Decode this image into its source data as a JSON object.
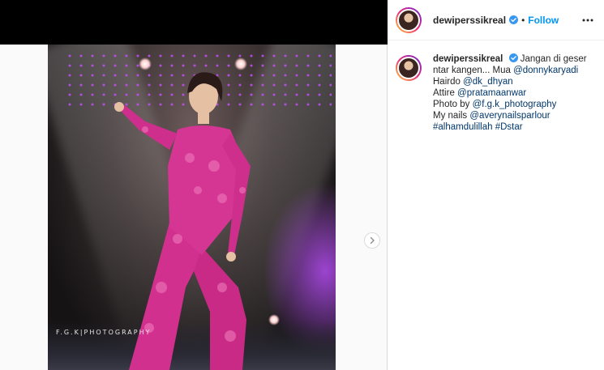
{
  "post": {
    "username": "dewiperssikreal",
    "separator": "•",
    "follow_label": "Follow",
    "watermark": "F.G.K|PHOTOGRAPHY"
  },
  "caption": {
    "line1_text": "Jangan di geser",
    "line2_text": "ntar kangen... Mua ",
    "line2_link": "@donnykaryadi",
    "line3_text": "Hairdo ",
    "line3_link": "@dk_dhyan",
    "line4_text": "Attire ",
    "line4_link": "@pratamaanwar",
    "line5_text": "Photo by ",
    "line5_link": "@f.g.k_photography",
    "line6_text": "My nails ",
    "line6_link": "@averynailsparlour",
    "line7_link1": "#alhamdulillah",
    "line7_link2": "#Dstar"
  },
  "icons": {
    "verified": "verified-badge-icon",
    "more": "more-options-icon",
    "next": "chevron-right-icon"
  },
  "colors": {
    "link": "#00376b",
    "follow": "#0095f6",
    "verified": "#3897f0",
    "dress": "#d2308f"
  }
}
